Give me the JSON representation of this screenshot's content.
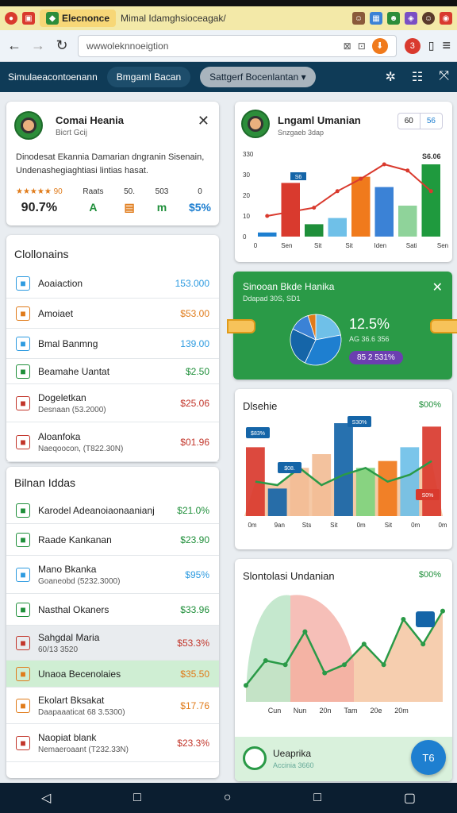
{
  "browser": {
    "tab_active": "Elecnonce",
    "tab_title": "Mimal Idamghsioceagak/",
    "url": "wwwoleknnoeigtion",
    "badge_count": "3"
  },
  "appbar": {
    "title": "Simulaeacontoenann",
    "pill1": "Bmgaml Bacan",
    "pill2": "Sattgerf Bocenlantan"
  },
  "profile": {
    "name": "Comai Heania",
    "subtitle": "Bicrt Gcij",
    "desc_line1": "Dinodesat Ekannia Damarian dngranin Sisenain,",
    "desc_line2": "Undenashegiaghtiasi lintias hasat.",
    "stat_labels": [
      "★★★★★ 90",
      "Raats",
      "50.",
      "503",
      "0"
    ],
    "stat_values": [
      "90.7%",
      "A",
      "▤",
      "m",
      "$5%"
    ],
    "stat_colors": [
      "#222",
      "#1f8f3a",
      "#e07b1a",
      "#1f8f3a",
      "#1e7fd0"
    ]
  },
  "collections": {
    "title": "Clollonains",
    "items": [
      {
        "label": "Aoaiaction",
        "sub": "",
        "value": "153.000",
        "color": "#2e9be0",
        "icon": "document-icon"
      },
      {
        "label": "Amoiaet",
        "sub": "",
        "value": "$53.00",
        "color": "#e07b1a",
        "icon": "circle-icon"
      },
      {
        "label": "Bmal Banmng",
        "sub": "",
        "value": "139.00",
        "color": "#2e9be0",
        "icon": "people-icon"
      },
      {
        "label": "Beamahe Uantat",
        "sub": "",
        "value": "$2.50",
        "color": "#1f8f3a",
        "icon": "card-icon"
      },
      {
        "label": "Dogeletkan",
        "sub": "Desnaan (53.2000)",
        "value": "$25.06",
        "color": "#c2352a",
        "icon": "inbox-icon"
      },
      {
        "label": "Aloanfoka",
        "sub": "Naeqoocon, (T822.30N)",
        "value": "$01.96",
        "color": "#c2352a",
        "icon": "briefcase-icon"
      }
    ]
  },
  "bilinan": {
    "title": "Bilnan Iddas",
    "items": [
      {
        "label": "Karodel Adeanoiaonaanianj",
        "sub": "",
        "value": "$21.0%",
        "color": "#1f8f3a",
        "icon": "id-card-icon"
      },
      {
        "label": "Raade Kankanan",
        "sub": "",
        "value": "$23.90",
        "color": "#1f8f3a",
        "icon": "chart-circle-icon"
      },
      {
        "label": "Mano Bkanka",
        "sub": "Goaneobd (5232.3000)",
        "value": "$95%",
        "color": "#2e9be0",
        "icon": "person-icon"
      },
      {
        "label": "Nasthal Okaners",
        "sub": "",
        "value": "$33.96",
        "color": "#1f8f3a",
        "icon": "trend-icon"
      },
      {
        "label": "Sahgdal Maria",
        "sub": "60/13 3520",
        "value": "$53.3%",
        "color": "#c2352a",
        "icon": "flag-icon"
      },
      {
        "label": "Unaoa Becenolaies",
        "sub": "",
        "value": "$35.50",
        "color": "#e07b1a",
        "icon": "tag-icon"
      },
      {
        "label": "Ekolart Bksakat",
        "sub": "Daapaaaticat 68 3.5300)",
        "value": "$17.76",
        "color": "#e07b1a",
        "icon": "line-chart-icon"
      },
      {
        "label": "Naopiat blank",
        "sub": "Nemaeroaant (T232.33N)",
        "value": "$23.3%",
        "color": "#c2352a",
        "icon": "heart-icon"
      }
    ]
  },
  "card_chart1": {
    "name": "Lngaml Umanian",
    "subtitle": "Snzgaeb 3dap",
    "btn1": "60",
    "btn2": "56",
    "value_label": "S6.06",
    "tag": "S6",
    "colors": [
      "#1e7fd0",
      "#d93a2e",
      "#1f8f3a",
      "#6fc0e8",
      "#f07a1c",
      "#3b82d6",
      "#8fd39a",
      "#1f9a3e"
    ]
  },
  "chart1": {
    "type": "bar",
    "categories": [
      "0",
      "Sen",
      "Sit",
      "Sit",
      "Iden",
      "Sati",
      "Sen"
    ],
    "values": [
      2,
      26,
      6,
      9,
      29,
      24,
      15,
      35
    ],
    "line": [
      10,
      12,
      14,
      22,
      28,
      35,
      32,
      22
    ],
    "yticks": [
      "0",
      "10",
      "20",
      "30",
      "330"
    ],
    "ylim": [
      0,
      40
    ]
  },
  "promo": {
    "title": "Sinooan Bkde Hanika",
    "sub": "Ddapad 30S, SD1",
    "value": "12.5%",
    "sub2": "AG 36.6 356",
    "badge": "85 2 531%",
    "pie_colors": [
      "#6fc0e8",
      "#1e7fd0",
      "#1565a8",
      "#3b82d6",
      "#e07b1a"
    ],
    "pie": [
      22,
      35,
      25,
      13,
      5
    ]
  },
  "card_chart2": {
    "title": "Dlsehie",
    "value": "$00%",
    "tag1": "$83%",
    "tag2": "$08.",
    "tag3": "S30%",
    "tag4": "S0%"
  },
  "chart2": {
    "type": "bar",
    "categories": [
      "0m",
      "9an",
      "Sts",
      "Sit",
      "0m",
      "Sit",
      "0m",
      "0m"
    ],
    "bars": [
      20,
      8,
      14,
      18,
      27,
      14,
      16,
      20,
      26
    ],
    "area": [
      10,
      9,
      14,
      9,
      12,
      14,
      10,
      12,
      16
    ],
    "colors": [
      "#d93a2e",
      "#1565a8",
      "#f2bd96",
      "#f2bd96",
      "#1565a8",
      "#7ed47e",
      "#f07a1c",
      "#6fc0e8",
      "#d93a2e"
    ],
    "ylim": [
      0,
      30
    ]
  },
  "card_chart3": {
    "title": "Slontolasi Undanian",
    "value": "$00%",
    "footer_title": "Ueaprika",
    "footer_sub": "Accinia 3660",
    "fab": "T6"
  },
  "chart3": {
    "type": "area",
    "categories": [
      "Cun",
      "Nun",
      "20n",
      "Tam",
      "20e",
      "20m"
    ],
    "line": [
      4,
      10,
      9,
      17,
      7,
      9,
      14,
      9,
      20,
      14,
      22
    ],
    "ylim": [
      0,
      25
    ]
  }
}
